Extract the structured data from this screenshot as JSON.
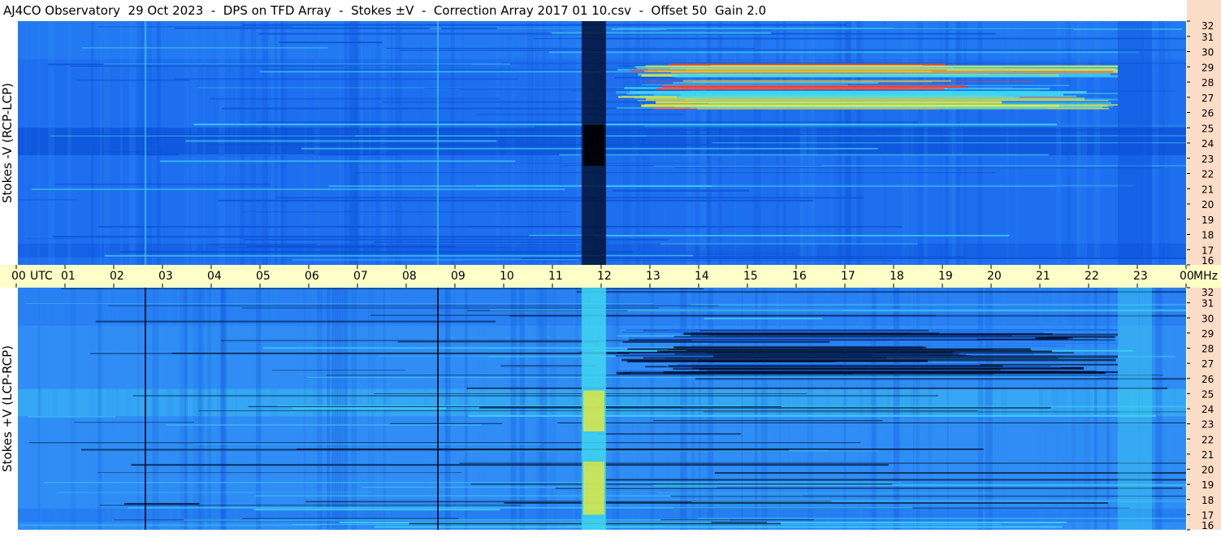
{
  "header": {
    "title": "AJ4CO Observatory  29 Oct 2023  -  DPS on TFD Array  -  Stokes ±V  -  Correction Array 2017 01 10.csv  -  Offset 50  Gain 2.0"
  },
  "chart_data": {
    "type": "heatmap",
    "panels": [
      {
        "ylabel": "Stokes -V (RCP-LCP)",
        "sense": "negative"
      },
      {
        "ylabel": "Stokes +V (LCP-RCP)",
        "sense": "positive"
      }
    ],
    "time_axis": {
      "utc_label": "UTC",
      "unit_label": "MHz",
      "ticks": [
        "00",
        "01",
        "02",
        "03",
        "04",
        "05",
        "06",
        "07",
        "08",
        "09",
        "10",
        "11",
        "12",
        "13",
        "14",
        "15",
        "16",
        "17",
        "18",
        "19",
        "20",
        "21",
        "22",
        "23",
        "00"
      ],
      "range_hours": [
        0,
        24
      ]
    },
    "freq_axis": {
      "ticks": [
        "32",
        "31",
        "30",
        "29",
        "28",
        "27",
        "26",
        "25",
        "24",
        "23",
        "22",
        "21",
        "20",
        "19",
        "18",
        "17",
        "16"
      ],
      "range_mhz": [
        16,
        32
      ]
    },
    "features": [
      {
        "kind": "vertical-line",
        "utc_hour": 2.65
      },
      {
        "kind": "vertical-line",
        "utc_hour": 8.65
      },
      {
        "kind": "dropout-band",
        "utc_start": 11.6,
        "utc_end": 12.1
      },
      {
        "kind": "activity-band",
        "utc_start": 12.3,
        "utc_end": 22.6,
        "freq_low": 26.3,
        "freq_high": 29.3
      },
      {
        "kind": "edge-band",
        "utc_start": 22.6,
        "utc_end": 23.3
      }
    ],
    "colors": {
      "background_deep": "#0a4fd6",
      "background_mid": "#1e6ff0",
      "background_light": "#2f8df5",
      "cyan": "#3fd6f0",
      "yellow": "#e8e83a",
      "red": "#ff3b2f",
      "dark": "#021236",
      "axis_band": "#ffffc8",
      "freq_strip": "#fbdcc6"
    }
  }
}
